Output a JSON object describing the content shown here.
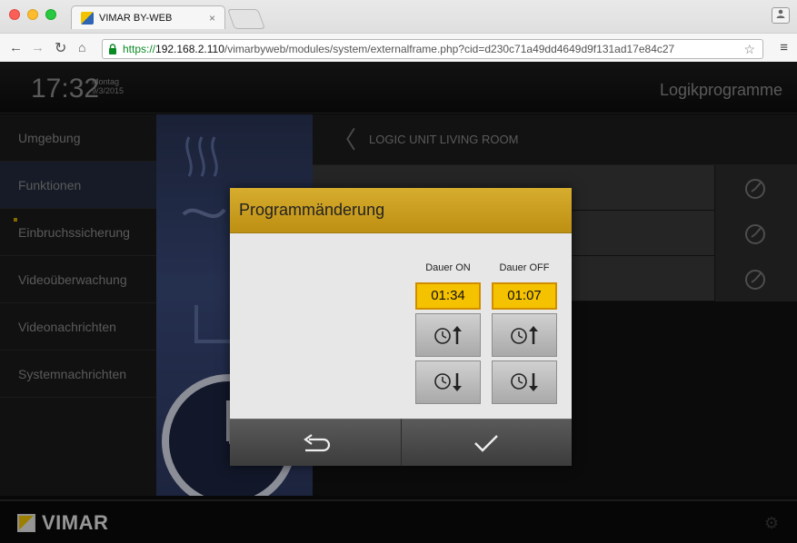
{
  "browser": {
    "tab_title": "VIMAR BY-WEB",
    "tab_close": "×",
    "url_scheme": "https://",
    "url_host": "192.168.2.110",
    "url_path": "/vimarbyweb/modules/system/externalframe.php?cid=d230c71a49dd4649d9f131ad17e84c27"
  },
  "header": {
    "time": "17:32",
    "weekday": "Montag",
    "date": "9/3/2015",
    "section_title": "Logikprogramme"
  },
  "sidebar": {
    "items": [
      {
        "label": "Umgebung"
      },
      {
        "label": "Funktionen"
      },
      {
        "label": "Einbruchssicherung"
      },
      {
        "label": "Videoüberwachung"
      },
      {
        "label": "Videonachrichten"
      },
      {
        "label": "Systemnachrichten"
      }
    ]
  },
  "main": {
    "back_glyph": "〈",
    "header_title": "LOGIC UNIT LIVING ROOM"
  },
  "modal": {
    "title": "Programmänderung",
    "on": {
      "label": "Dauer ON",
      "value": "01:34"
    },
    "off": {
      "label": "Dauer OFF",
      "value": "01:07"
    }
  },
  "footer": {
    "brand": "VIMAR"
  },
  "icons": {
    "back": "back-arrow-icon",
    "confirm": "checkmark-icon",
    "timer_up": "timer-up-icon",
    "timer_down": "timer-down-icon",
    "settings": "gear-icon"
  },
  "colors": {
    "accent_gold": "#d7ad2e",
    "value_yellow": "#f5c200",
    "https_green": "#0a8a23"
  }
}
